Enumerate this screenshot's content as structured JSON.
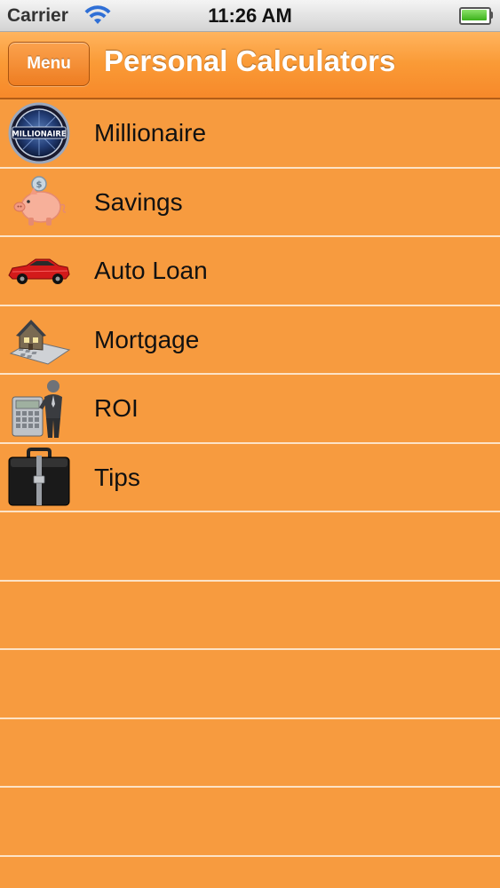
{
  "status_bar": {
    "carrier": "Carrier",
    "time": "11:26 AM",
    "wifi_icon": "wifi-icon",
    "battery_icon": "battery-full-icon"
  },
  "nav": {
    "menu_label": "Menu",
    "title": "Personal Calculators"
  },
  "items": [
    {
      "label": "Millionaire",
      "icon": "millionaire-logo-icon"
    },
    {
      "label": "Savings",
      "icon": "piggy-bank-icon"
    },
    {
      "label": "Auto Loan",
      "icon": "sports-car-icon"
    },
    {
      "label": "Mortgage",
      "icon": "house-calculator-icon"
    },
    {
      "label": "ROI",
      "icon": "businessman-calculator-icon"
    },
    {
      "label": "Tips",
      "icon": "briefcase-icon"
    }
  ],
  "colors": {
    "background": "#F79B3F",
    "nav_bar": "#F7892A",
    "separator": "#FDE3C6"
  }
}
